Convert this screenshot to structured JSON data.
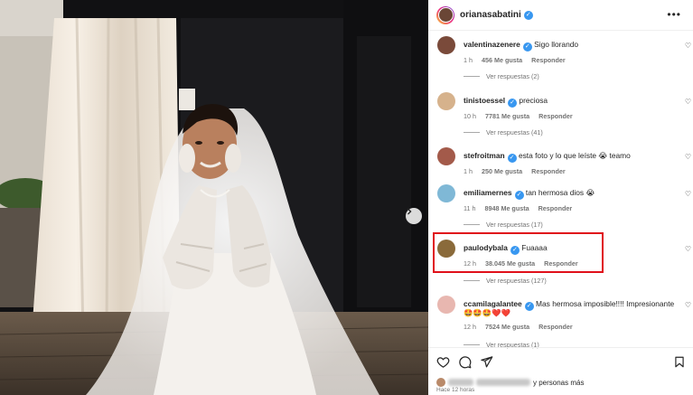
{
  "post": {
    "owner": "orianasabatini",
    "more_icon": "more-horizontal-icon"
  },
  "comments": [
    {
      "user": "valentinazenere",
      "text": "Sigo llorando",
      "time": "1 h",
      "likes": "456 Me gusta",
      "reply": "Responder",
      "replies": "Ver respuestas (2)",
      "avatar_color": "#7a4a3a"
    },
    {
      "user": "tinistoessel",
      "text": "preciosa",
      "time": "10 h",
      "likes": "7781 Me gusta",
      "reply": "Responder",
      "replies": "Ver respuestas (41)",
      "avatar_color": "#d6b28c"
    },
    {
      "user": "stefroitman",
      "text": "esta foto y lo que leíste 😭 teamo",
      "time": "1 h",
      "likes": "250 Me gusta",
      "reply": "Responder",
      "replies": "",
      "avatar_color": "#a35a4a"
    },
    {
      "user": "emiliamernes",
      "text": "tan hermosa dios 😭",
      "time": "11 h",
      "likes": "8948 Me gusta",
      "reply": "Responder",
      "replies": "Ver respuestas (17)",
      "avatar_color": "#7fb8d6"
    },
    {
      "user": "paulodybala",
      "text": "Fuaaaa",
      "time": "12 h",
      "likes": "38.045 Me gusta",
      "reply": "Responder",
      "replies": "Ver respuestas (127)",
      "avatar_color": "#8a6a3a"
    },
    {
      "user": "ccamilagalantee",
      "text": "Mas hermosa imposible!!!! Impresionante",
      "emoji_line": "🤩🤩🤩❤️❤️",
      "time": "12 h",
      "likes": "7524 Me gusta",
      "reply": "Responder",
      "replies": "Ver respuestas (1)",
      "avatar_color": "#e8b7b0"
    }
  ],
  "footer": {
    "likes_suffix": "y personas más",
    "time_ago": "Hace 12 horas"
  },
  "colors": {
    "highlight": "#e0101a",
    "verified": "#3897f0",
    "meta_text": "#737373"
  }
}
